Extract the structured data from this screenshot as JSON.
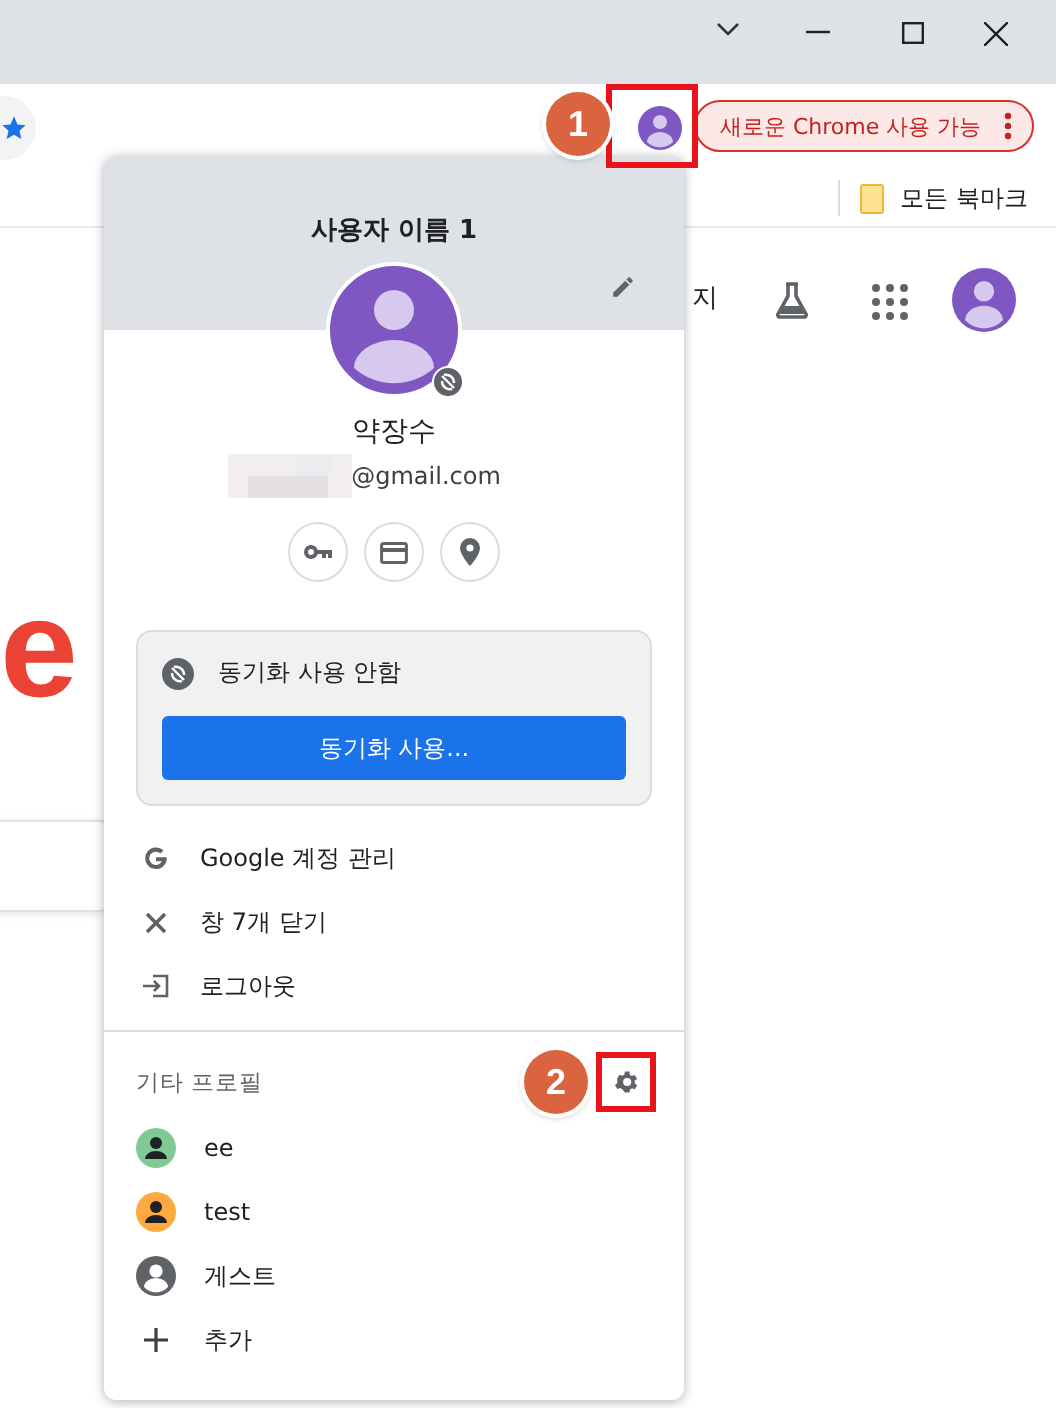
{
  "toolbar": {
    "update_button": "새로운 Chrome 사용 가능"
  },
  "bookmarks_bar": {
    "all_bookmarks": "모든 북마크"
  },
  "page": {
    "logo_fragment": "e",
    "partial_text": "지"
  },
  "callouts": [
    "1",
    "2"
  ],
  "profile_menu": {
    "title": "사용자 이름 1",
    "name": "약장수",
    "email": "@gmail.com",
    "sync": {
      "status": "동기화 사용 안함",
      "button": "동기화 사용..."
    },
    "actions": [
      {
        "kind": "google",
        "label": "Google 계정 관리"
      },
      {
        "kind": "close",
        "label": "창 7개 닫기"
      },
      {
        "kind": "logout",
        "label": "로그아웃"
      }
    ],
    "other_profiles_label": "기타 프로필",
    "profiles": [
      {
        "kind": "profile",
        "name": "ee",
        "color": "#81c995"
      },
      {
        "kind": "profile",
        "name": "test",
        "color": "#fdab40"
      },
      {
        "kind": "guest",
        "name": "게스트"
      },
      {
        "kind": "add",
        "name": "추가"
      }
    ]
  }
}
